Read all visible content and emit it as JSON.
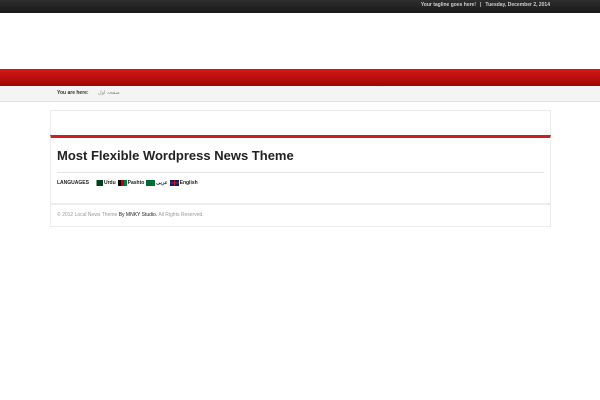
{
  "topbar": {
    "tagline": "Your tagline goes here!",
    "separator": "|",
    "date": "Tuesday, December 2, 2014"
  },
  "breadcrumb": {
    "label": "You are here:",
    "current": "صفحہ اول"
  },
  "main": {
    "title": "Most Flexible Wordpress News Theme",
    "languages_label": "LANGUAGES",
    "languages": [
      {
        "flag": "pakistan-flag-icon",
        "label": "Urdu"
      },
      {
        "flag": "afghanistan-flag-icon",
        "label": "Pashto"
      },
      {
        "flag": "saudi-flag-icon",
        "label": "عربی"
      },
      {
        "flag": "uk-flag-icon",
        "label": "English"
      }
    ]
  },
  "footer": {
    "copyright": "© 2012 Local News Theme",
    "by": "By MNKY Studio.",
    "rights": "All Rights Reserved."
  },
  "colors": {
    "accent_red": "#cc1f1f",
    "topbar_bg": "#222222"
  }
}
